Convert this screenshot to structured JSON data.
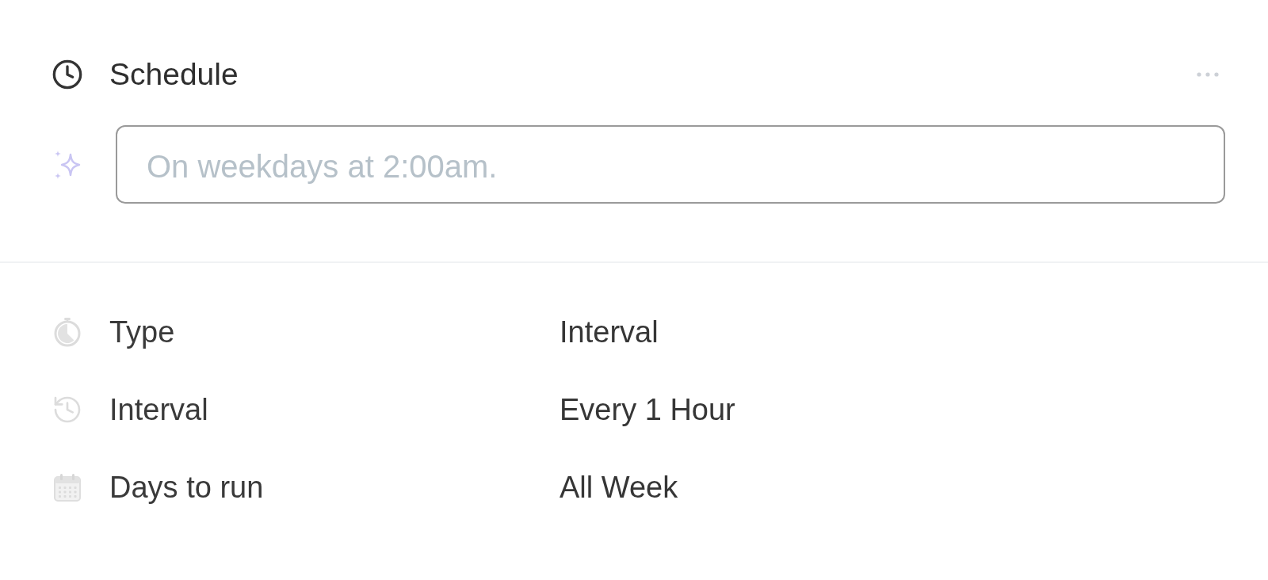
{
  "header": {
    "title": "Schedule"
  },
  "prompt": {
    "placeholder": "On weekdays at 2:00am."
  },
  "fields": [
    {
      "kind": "timer",
      "label": "Type",
      "value": "Interval"
    },
    {
      "kind": "history",
      "label": "Interval",
      "value": "Every 1 Hour"
    },
    {
      "kind": "calendar",
      "label": "Days to run",
      "value": "All Week"
    }
  ]
}
